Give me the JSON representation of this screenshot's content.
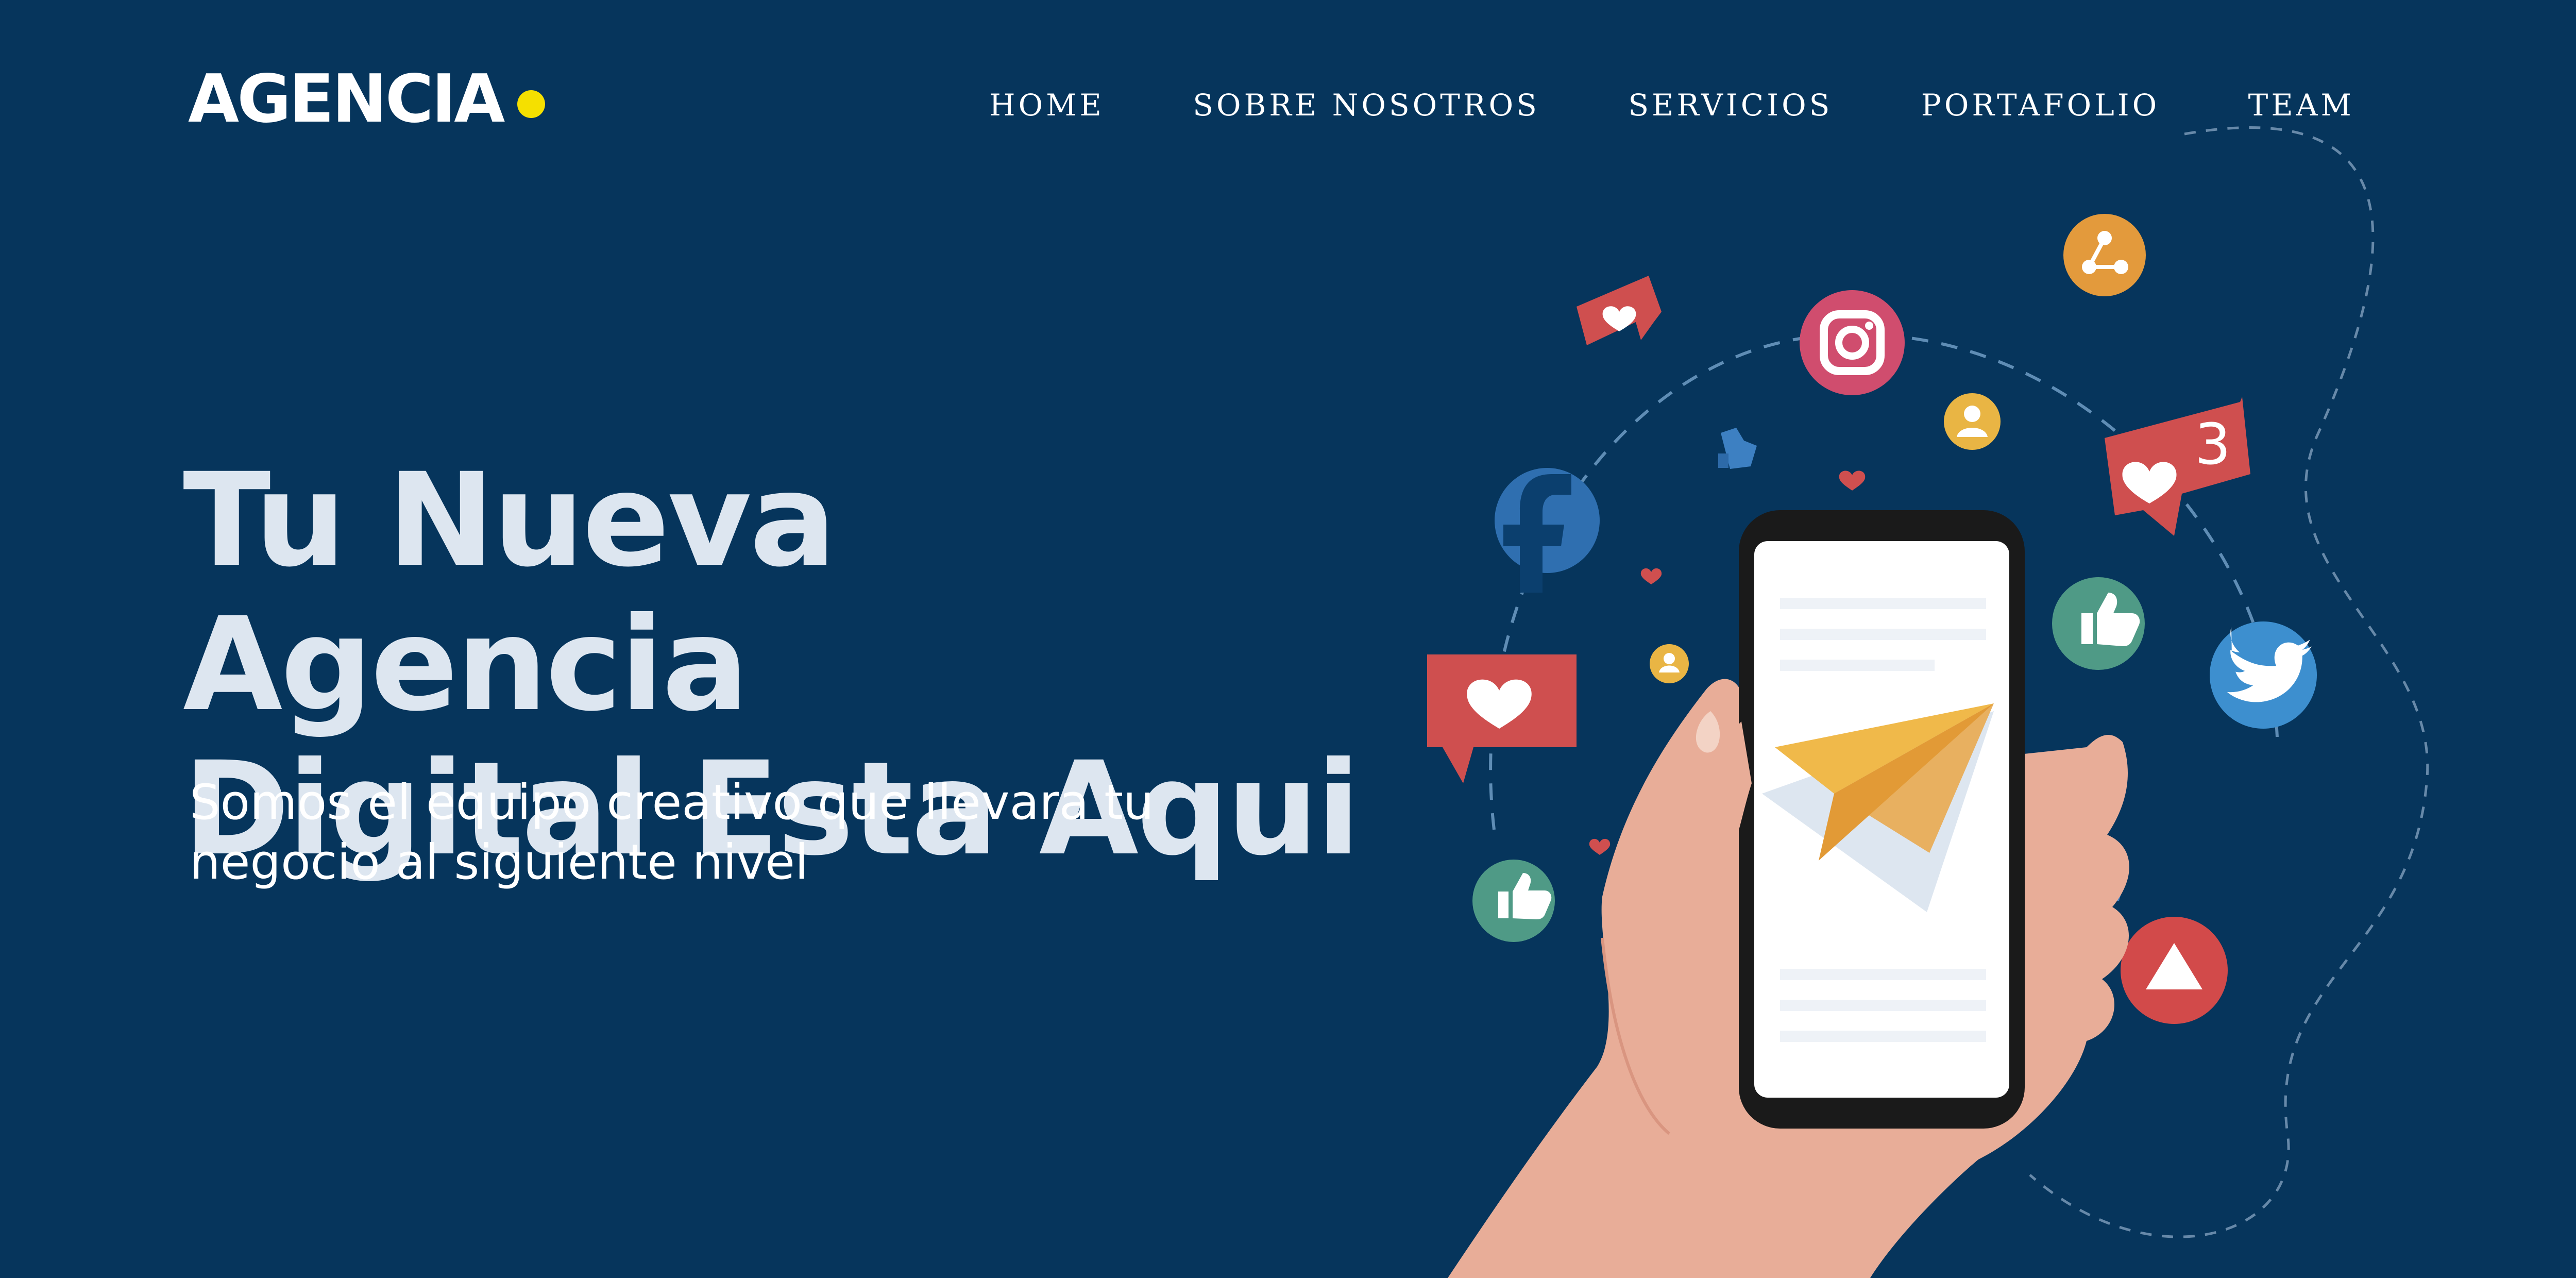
{
  "brand": {
    "name": "AGENCIA",
    "dot_color": "#f5e000"
  },
  "nav": {
    "items": [
      {
        "label": "HOME"
      },
      {
        "label": "SOBRE NOSOTROS"
      },
      {
        "label": "SERVICIOS"
      },
      {
        "label": "PORTAFOLIO"
      },
      {
        "label": "TEAM"
      }
    ]
  },
  "hero": {
    "title_line1": "Tu Nueva Agencia",
    "title_line2": "Digital Esta Aqui",
    "subtitle_line1": "Somos el equipo creativo que llevara tu",
    "subtitle_line2": "negocio al siguiente nivel"
  },
  "illustration": {
    "icons": [
      "facebook-icon",
      "instagram-icon",
      "twitter-icon",
      "youtube-icon",
      "share-icon",
      "like-icon",
      "heart-icon",
      "user-icon",
      "paper-plane-icon"
    ],
    "notification_count": "3",
    "colors": {
      "background": "#06355c",
      "facebook": "#2f6fb0",
      "instagram": "#d04d6e",
      "twitter": "#3d8fcf",
      "youtube": "#d24a4a",
      "share": "#e39a3c",
      "like_green": "#4f9a86",
      "heart_red": "#cf4f4f",
      "user_yellow": "#e9b544",
      "hand": "#e8ad98",
      "plane": "#f0b94a"
    }
  }
}
